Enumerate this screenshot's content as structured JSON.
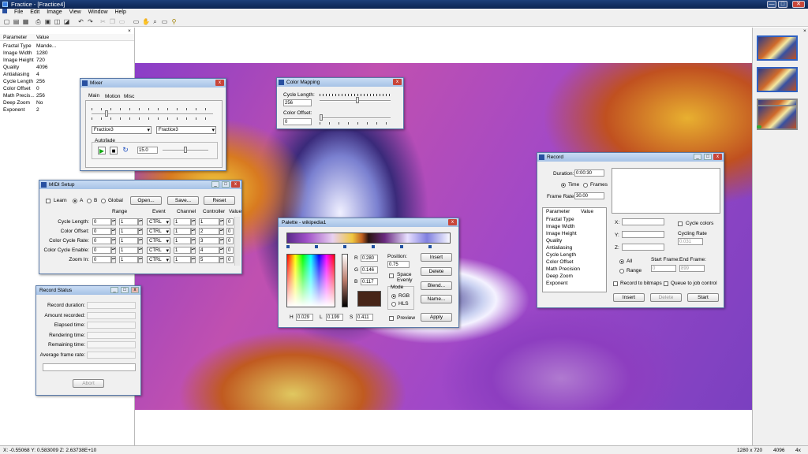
{
  "app": {
    "title": "Fractice - [Fractice4]",
    "win_min": "—",
    "win_max": "□",
    "win_close": "✕"
  },
  "menu": [
    "File",
    "Edit",
    "Image",
    "View",
    "Window",
    "Help"
  ],
  "params": {
    "h1": "Parameter",
    "h2": "Value",
    "close": "×",
    "rows": [
      [
        "Fractal Type",
        "Mande..."
      ],
      [
        "Image Width",
        "1280"
      ],
      [
        "Image Height",
        "720"
      ],
      [
        "Quality",
        "4096"
      ],
      [
        "Antialiasing",
        "4"
      ],
      [
        "Cycle Length",
        "256"
      ],
      [
        "Color Offset",
        "0"
      ],
      [
        "Math Precis...",
        "256"
      ],
      [
        "Deep Zoom",
        "No"
      ],
      [
        "Exponent",
        "2"
      ]
    ]
  },
  "right_close": "×",
  "mixer": {
    "title": "Mixer",
    "tabs": [
      "Main",
      "Motion",
      "Misc"
    ],
    "sel1": "Fractice3",
    "sel2": "Fractice3",
    "autofade": "Autofade",
    "fade_value": "15.0",
    "close": "x"
  },
  "color_mapping": {
    "title": "Color Mapping",
    "cycle_label": "Cycle Length:",
    "cycle_value": "256",
    "offset_label": "Color Offset:",
    "offset_value": "0",
    "close": "x"
  },
  "midi": {
    "title": "MIDI Setup",
    "learn": "Learn",
    "a": "A",
    "b": "B",
    "global": "Global",
    "open": "Open...",
    "save": "Save...",
    "reset": "Reset",
    "close": "x",
    "cols": [
      "Range",
      "Event",
      "Channel",
      "Controller",
      "Value"
    ],
    "rows": [
      [
        "Cycle Length:",
        "0",
        "1",
        "CTRL",
        "1",
        "1",
        "0"
      ],
      [
        "Color Offset:",
        "0",
        "1",
        "CTRL",
        "1",
        "2",
        "0"
      ],
      [
        "Color Cycle Rate:",
        "0",
        "1",
        "CTRL",
        "1",
        "3",
        "0"
      ],
      [
        "Color Cycle Enable:",
        "0",
        "1",
        "CTRL",
        "1",
        "4",
        "0"
      ],
      [
        "Zoom In:",
        "0",
        "1",
        "CTRL",
        "1",
        "5",
        "0"
      ]
    ]
  },
  "record_status": {
    "title": "Record Status",
    "labels": [
      "Record duration:",
      "Amount recorded:",
      "Elapsed time:",
      "Rendering time:",
      "Remaining time:",
      "Average frame rate:"
    ],
    "abort": "Abort"
  },
  "palette": {
    "title": "Palette - wikipedia1",
    "r": "R",
    "r_val": "0.280",
    "g": "G",
    "g_val": "0.146",
    "b": "B",
    "b_val": "0.117",
    "position": "Position:",
    "pos_val": "0.75",
    "space_evenly": "Space Evenly",
    "mode": "Mode",
    "rgb": "RGB",
    "hls": "HLS",
    "preview": "Preview",
    "h": "H",
    "h_val": "0.029",
    "l": "L",
    "l_val": "0.199",
    "s": "S",
    "s_val": "0.411",
    "insert": "Insert",
    "delete": "Delete",
    "blend": "Blend...",
    "name": "Name...",
    "apply": "Apply",
    "close": "x"
  },
  "record": {
    "title": "Record",
    "duration_label": "Duration:",
    "duration": "0:00:30",
    "time": "Time",
    "frames": "Frames",
    "frame_rate_label": "Frame Rate:",
    "frame_rate": "30.00",
    "param_h1": "Parameter",
    "param_h2": "Value",
    "params": [
      "Fractal Type",
      "Image Width",
      "Image Height",
      "Quality",
      "Antialiasing",
      "Cycle Length",
      "Color Offset",
      "Math Precision",
      "Deep Zoom",
      "Exponent"
    ],
    "x": "X:",
    "y": "Y:",
    "z": "Z:",
    "cycle_colors": "Cycle colors",
    "cycling_rate": "Cycling Rate",
    "cycling_rate_val": "0.031",
    "all": "All",
    "range": "Range",
    "start_frame": "Start Frame:",
    "start_val": "0",
    "end_frame": "End Frame:",
    "end_val": "899",
    "record_bitmaps": "Record to bitmaps",
    "queue": "Queue to job control",
    "insert": "Insert",
    "delete": "Delete",
    "start": "Start",
    "close": "x"
  },
  "status": {
    "coords": "X: -0.55068  Y: 0.583009  Z: 2.63738E+10",
    "size": "1280 x 720",
    "quality": "4096",
    "zoom": "4x"
  }
}
